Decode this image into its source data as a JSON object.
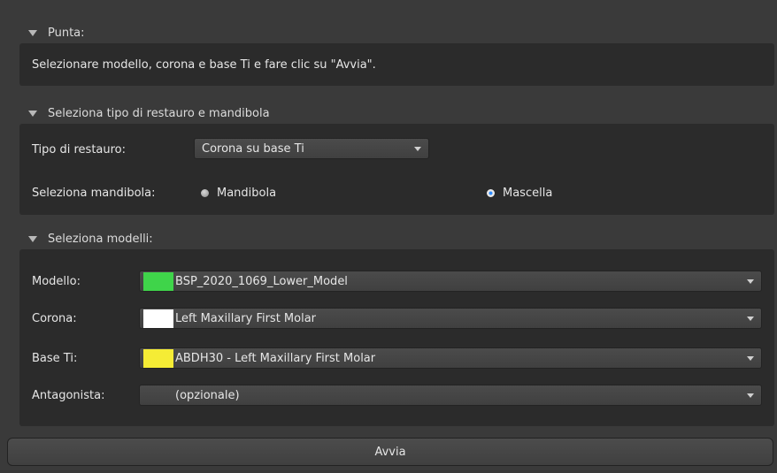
{
  "tip": {
    "header": "Punta:",
    "message": "Selezionare modello, corona e base Ti e fare clic su \"Avvia\"."
  },
  "restoration": {
    "header": "Seleziona tipo di restauro e mandibola",
    "type_label": "Tipo di restauro:",
    "type_value": "Corona su base Ti",
    "jaw_label": "Seleziona mandibola:",
    "jaw_options": [
      "Mandibola",
      "Mascella"
    ],
    "jaw_selected": "Mascella"
  },
  "models": {
    "header": "Seleziona modelli:",
    "rows": [
      {
        "label": "Modello:",
        "value": "BSP_2020_1069_Lower_Model",
        "color": "#3fd44a"
      },
      {
        "label": "Corona:",
        "value": "Left Maxillary First Molar",
        "color": "#ffffff"
      },
      {
        "label": "Base Ti:",
        "value": "ABDH30 - Left Maxillary First Molar",
        "color": "#f5ec35"
      },
      {
        "label": "Antagonista:",
        "value": "(opzionale)",
        "color": ""
      }
    ]
  },
  "start_button": "Avvia",
  "colors": {
    "background": "#3a3a3a",
    "panel": "#2b2b2b",
    "radio_selected": "#2f8cff"
  }
}
